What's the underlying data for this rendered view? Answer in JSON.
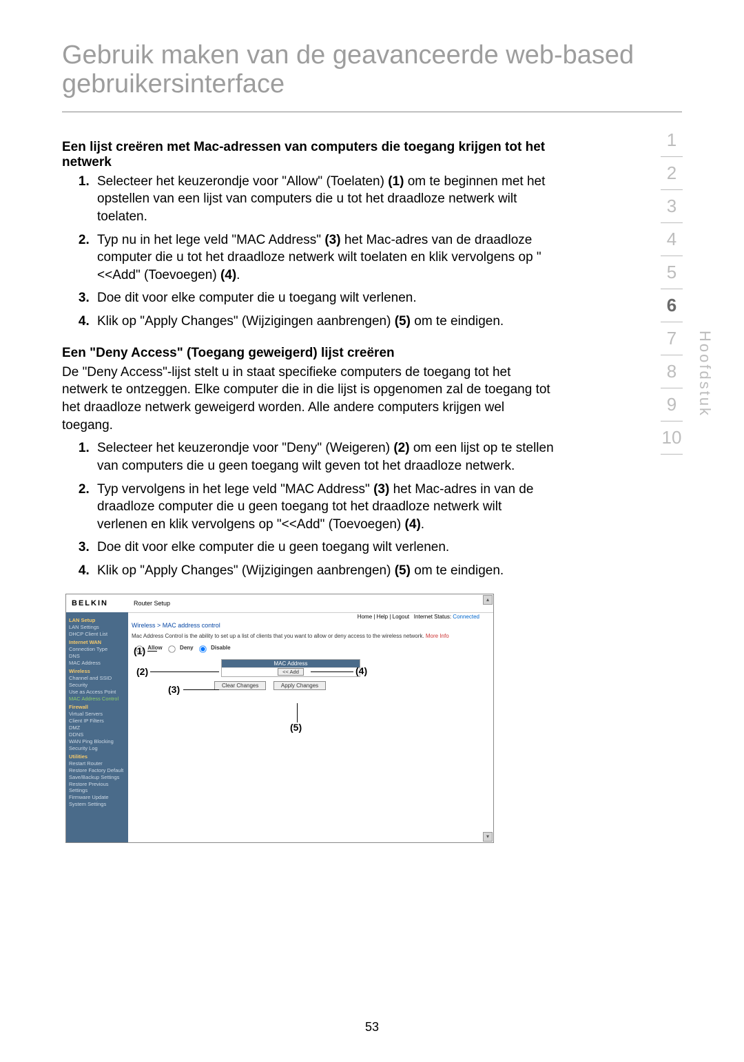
{
  "page_title": "Gebruik maken van de geavanceerde web-based gebruikersinterface",
  "section1": {
    "heading": "Een lijst creëren met Mac-adressen van computers die toegang krijgen tot het netwerk",
    "items": [
      {
        "pre": "Selecteer het keuzerondje voor \"Allow\" (Toelaten) ",
        "b1": "(1)",
        "post": " om te beginnen met het opstellen van een lijst van computers die u tot het draadloze netwerk wilt toelaten."
      },
      {
        "pre": "Typ nu in het lege veld \"MAC Address\" ",
        "b1": "(3)",
        "mid": " het Mac-adres van de draadloze computer die u tot het draadloze netwerk wilt toelaten en klik vervolgens op \"<<Add\" (Toevoegen) ",
        "b2": "(4)",
        "post": "."
      },
      {
        "pre": "Doe dit voor elke computer die u toegang wilt verlenen.",
        "b1": "",
        "post": ""
      },
      {
        "pre": "Klik op \"Apply Changes\" (Wijzigingen aanbrengen) ",
        "b1": "(5)",
        "post": " om te eindigen."
      }
    ]
  },
  "section2": {
    "heading": "Een \"Deny Access\" (Toegang geweigerd) lijst creëren",
    "intro": "De \"Deny Access\"-lijst stelt u in staat specifieke computers de toegang tot het netwerk te ontzeggen. Elke computer die in die lijst is opgenomen zal de toegang tot het draadloze netwerk geweigerd worden. Alle andere computers krijgen wel toegang.",
    "items": [
      {
        "pre": "Selecteer het keuzerondje voor \"Deny\" (Weigeren) ",
        "b1": "(2)",
        "post": " om een lijst op te stellen van computers die u geen toegang wilt geven tot het draadloze netwerk."
      },
      {
        "pre": "Typ vervolgens in het lege veld \"MAC Address\" ",
        "b1": "(3)",
        "mid": " het Mac-adres in van de draadloze computer die u geen toegang tot het draadloze netwerk wilt verlenen en klik vervolgens op \"<<Add\" (Toevoegen) ",
        "b2": "(4)",
        "post": "."
      },
      {
        "pre": "Doe dit voor elke computer die u geen toegang wilt verlenen.",
        "b1": "",
        "post": ""
      },
      {
        "pre": "Klik op \"Apply Changes\" (Wijzigingen aanbrengen) ",
        "b1": "(5)",
        "post": " om te eindigen."
      }
    ]
  },
  "chapnav": {
    "items": [
      "1",
      "2",
      "3",
      "4",
      "5",
      "6",
      "7",
      "8",
      "9",
      "10"
    ],
    "active": "6",
    "label": "Hoofdstuk"
  },
  "page_number": "53",
  "shot": {
    "brand": "BELKIN",
    "router_setup": "Router Setup",
    "toplinks": {
      "home": "Home",
      "help": "Help",
      "logout": "Logout",
      "status_label": "Internet Status:",
      "status_value": "Connected"
    },
    "breadcrumb": "Wireless > MAC address control",
    "desc": "Mac Address Control is the ability to set up a list of clients that you want to allow or deny access to the wireless network. ",
    "more_info": "More Info",
    "radio_allow": "Allow",
    "radio_deny": "Deny",
    "radio_disable": "Disable",
    "mac_header": "MAC Address",
    "add_btn": "<< Add",
    "clear_btn": "Clear Changes",
    "apply_btn": "Apply Changes",
    "callouts": {
      "c1": "(1)",
      "c2": "(2)",
      "c3": "(3)",
      "c4": "(4)",
      "c5": "(5)"
    },
    "sidebar": {
      "lan_setup": "LAN Setup",
      "lan_settings": "LAN Settings",
      "dhcp": "DHCP Client List",
      "internet_wan": "Internet WAN",
      "conn_type": "Connection Type",
      "dns": "DNS",
      "mac_addr": "MAC Address",
      "wireless": "Wireless",
      "chan_ssid": "Channel and SSID",
      "security": "Security",
      "use_ap": "Use as Access Point",
      "mac_ctrl": "MAC Address Control",
      "firewall": "Firewall",
      "vservers": "Virtual Servers",
      "cfilters": "Client IP Filters",
      "dmz": "DMZ",
      "ddns": "DDNS",
      "wan_ping": "WAN Ping Blocking",
      "seclog": "Security Log",
      "utilities": "Utilities",
      "restart": "Restart Router",
      "restore_def": "Restore Factory Default",
      "save_backup": "Save/Backup Settings",
      "restore_prev": "Restore Previous Settings",
      "fw_update": "Firmware Update",
      "sys_settings": "System Settings"
    }
  }
}
